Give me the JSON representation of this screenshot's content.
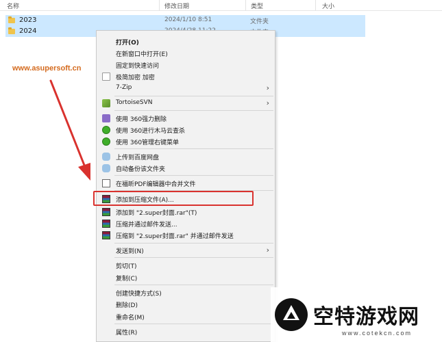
{
  "header": {
    "name": "名称",
    "date": "修改日期",
    "type": "类型",
    "size": "大小"
  },
  "rows": [
    {
      "name": "2023",
      "date": "2024/1/10 8:51",
      "type": "文件夹"
    },
    {
      "name": "2024",
      "date": "2024/4/28 11:22",
      "type": "文件夹"
    }
  ],
  "watermark_url": "www.asupersoft.cn",
  "menu": {
    "open": "打开(O)",
    "open_new_window": "在新窗口中打开(E)",
    "pin_quick_access": "固定到快速访问",
    "encrypt": "极简加密 加密",
    "zip7": "7-Zip",
    "tortoise": "TortoiseSVN",
    "del360": "使用 360强力删除",
    "scan360": "使用 360进行木马云查杀",
    "manage360": "使用 360管理右键菜单",
    "upload_baidu": "上传到百度网盘",
    "auto_backup": "自动备份该文件夹",
    "foxit_merge": "在福昕PDF编辑器中合并文件",
    "add_archive": "添加到压缩文件(A)...",
    "add_rar": "添加到 \"2.super封面.rar\"(T)",
    "compress_email": "压缩并通过邮件发送...",
    "compress_rar_email": "压缩到 \"2.super封面.rar\" 并通过邮件发送",
    "send_to": "发送到(N)",
    "cut": "剪切(T)",
    "copy": "复制(C)",
    "create_shortcut": "创建快捷方式(S)",
    "delete": "删除(D)",
    "rename": "重命名(M)",
    "properties": "属性(R)",
    "submenu_arrow": "›"
  },
  "logo": {
    "title": "空特游戏网",
    "url": "www.cotekcn.com"
  },
  "colors": {
    "selection": "#cce8ff",
    "highlight_box": "#d9322e",
    "watermark": "#d46b1f"
  }
}
